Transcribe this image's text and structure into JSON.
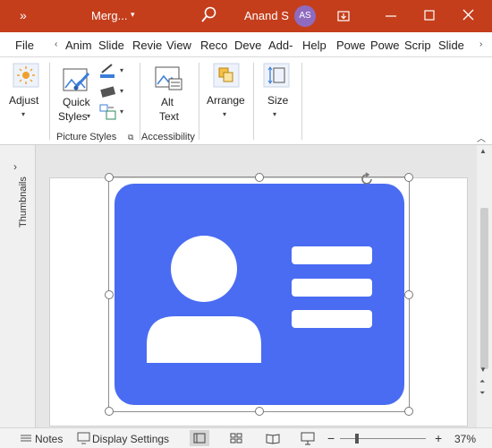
{
  "titlebar": {
    "qat_icon": "»",
    "doc_title": "Merg...",
    "doc_caret": "▾",
    "search_icon": "search-icon",
    "user_name": "Anand S",
    "avatar_initials": "AS",
    "accent": "#c43e1c",
    "avatar_color": "#8f6bbf"
  },
  "tabs": {
    "file": "File",
    "scroll_left": "‹",
    "items": [
      "Anim",
      "Slide",
      "Revie",
      "View",
      "Reco",
      "Deve",
      "Add-",
      "Help",
      "Powe",
      "Powe",
      "Scrip",
      "Slide"
    ],
    "scroll_right": "›"
  },
  "ribbon": {
    "adjust_label": "Adjust",
    "quick_label_1": "Quick",
    "quick_label_2": "Styles",
    "picture_styles_label": "Picture Styles",
    "alt_label_1": "Alt",
    "alt_label_2": "Text",
    "accessibility_label": "Accessibility",
    "arrange_label": "Arrange",
    "size_label": "Size",
    "caret": "▾",
    "launcher": "⧉"
  },
  "workspace": {
    "thumbnails_label": "Thumbnails",
    "thumb_chevron": "›",
    "image_color": "#4a6cf2"
  },
  "statusbar": {
    "notes_label": "Notes",
    "display_settings_label": "Display Settings",
    "zoom_minus": "−",
    "zoom_plus": "+",
    "zoom_level": "37%"
  }
}
